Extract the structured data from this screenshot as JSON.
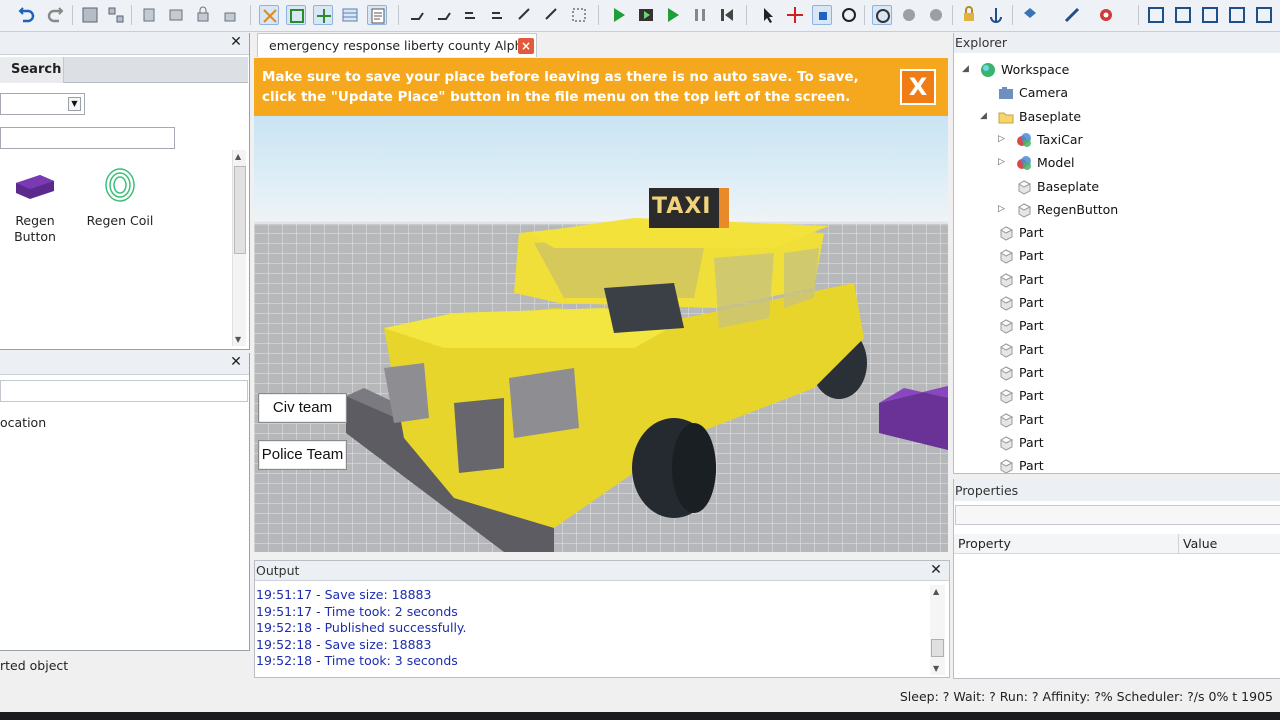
{
  "toolbar": {
    "icons": [
      "undo-icon",
      "redo-icon",
      "group-icon",
      "ungroup-icon",
      "anchor-icon",
      "weld-icon",
      "lock-icon",
      "unlock-icon",
      "select-mode-icon",
      "move-mode-icon",
      "scale-mode-icon",
      "grid-icon",
      "script-icon",
      "drag-icon",
      "rotate-icon",
      "tilt-icon",
      "resize-icon",
      "zoom-icon",
      "play-icon",
      "run-icon",
      "resume-icon",
      "pause-icon",
      "stop-icon",
      "pointer-icon",
      "move-icon",
      "scale-icon",
      "rotate-tool-icon",
      "collision-icon",
      "constraint-icon",
      "join-icon",
      "lock-part-icon",
      "anchor-part-icon",
      "paint-icon",
      "material-icon",
      "settings-icon",
      "view-top-icon",
      "view-front-icon",
      "view-side-icon",
      "view-fit-icon",
      "view-back-icon"
    ]
  },
  "toolbox": {
    "tab_search": "Search",
    "items": [
      {
        "label_line1": "Regen",
        "label_line2": "Button",
        "icon": "purple-block-icon"
      },
      {
        "label_line1": "Regen Coil",
        "label_line2": "",
        "icon": "green-coil-icon"
      }
    ]
  },
  "left_bottom": {
    "row_text": "ocation",
    "status_text": "rted object"
  },
  "document": {
    "tab_label": "emergency response liberty county Alpha",
    "close_symbol": "×"
  },
  "viewport": {
    "notice_line1": "Make sure to save your place before leaving as there is no auto save. To save,",
    "notice_line2": "click the \"Update Place\" button in the file menu on the top left of the screen.",
    "notice_close": "X",
    "taxi_sign": "TAXI",
    "buttons": {
      "civ_team": "Civ team",
      "police_team": "Police Team"
    }
  },
  "output": {
    "title": "Output",
    "lines": [
      "19:51:17 - Save size: 18883",
      "19:51:17 - Time took: 2 seconds",
      "19:52:18 - Published successfully.",
      "19:52:18 - Save size: 18883",
      "19:52:18 - Time took: 3 seconds"
    ]
  },
  "explorer": {
    "title": "Explorer",
    "tree": [
      {
        "label": "Workspace",
        "level": 0,
        "expander": "◢",
        "icon": "workspace-icon"
      },
      {
        "label": "Camera",
        "level": 1,
        "expander": "",
        "icon": "camera-icon"
      },
      {
        "label": "Baseplate",
        "level": 1,
        "expander": "◢",
        "icon": "folder-icon"
      },
      {
        "label": "TaxiCar",
        "level": 2,
        "expander": "▷",
        "icon": "model-icon"
      },
      {
        "label": "Model",
        "level": 2,
        "expander": "▷",
        "icon": "model-icon"
      },
      {
        "label": "Baseplate",
        "level": 2,
        "expander": "",
        "icon": "part-icon"
      },
      {
        "label": "RegenButton",
        "level": 2,
        "expander": "▷",
        "icon": "part-icon"
      },
      {
        "label": "Part",
        "level": 1,
        "expander": "",
        "icon": "part-icon"
      },
      {
        "label": "Part",
        "level": 1,
        "expander": "",
        "icon": "part-icon"
      },
      {
        "label": "Part",
        "level": 1,
        "expander": "",
        "icon": "part-icon"
      },
      {
        "label": "Part",
        "level": 1,
        "expander": "",
        "icon": "part-icon"
      },
      {
        "label": "Part",
        "level": 1,
        "expander": "",
        "icon": "part-icon"
      },
      {
        "label": "Part",
        "level": 1,
        "expander": "",
        "icon": "part-icon"
      },
      {
        "label": "Part",
        "level": 1,
        "expander": "",
        "icon": "part-icon"
      },
      {
        "label": "Part",
        "level": 1,
        "expander": "",
        "icon": "part-icon"
      },
      {
        "label": "Part",
        "level": 1,
        "expander": "",
        "icon": "part-icon"
      },
      {
        "label": "Part",
        "level": 1,
        "expander": "",
        "icon": "part-icon"
      },
      {
        "label": "Part",
        "level": 1,
        "expander": "",
        "icon": "part-icon"
      }
    ]
  },
  "properties": {
    "title": "Properties",
    "col_property": "Property",
    "col_value": "Value"
  },
  "status_bar": {
    "text": "Sleep: ? Wait: ? Run: ? Affinity: ?% Scheduler: ?/s 0%    t 1905"
  },
  "colors": {
    "banner": "#f5a81e",
    "taxi_yellow": "#f2e23a",
    "output_text": "#1c2cb0"
  }
}
